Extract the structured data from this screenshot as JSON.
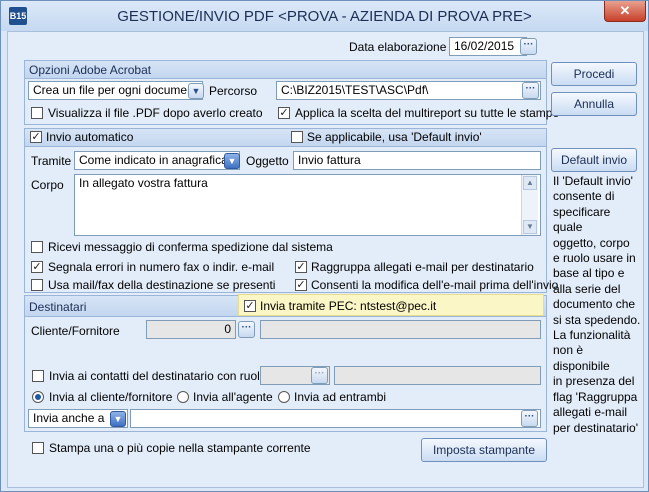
{
  "window": {
    "app_icon_text": "B15",
    "title": "GESTIONE/INVIO PDF <PROVA - AZIENDA DI PROVA PRE>",
    "close_glyph": "✕"
  },
  "header": {
    "data_label": "Data elaborazione",
    "data_value": "16/02/2015"
  },
  "opzioni": {
    "section_title": "Opzioni Adobe Acrobat",
    "file_mode": "Crea un file per ogni documento",
    "percorso_label": "Percorso",
    "percorso_value": "C:\\BIZ2015\\TEST\\ASC\\Pdf\\",
    "visualizza_label": "Visualizza il file .PDF dopo averlo creato",
    "visualizza_checked": false,
    "applica_label": "Applica la scelta del multireport su tutte le stampe",
    "applica_checked": true
  },
  "invio": {
    "auto_label": "Invio automatico",
    "auto_checked": true,
    "default_label": "Se applicabile, usa 'Default invio'",
    "default_checked": false,
    "tramite_label": "Tramite",
    "tramite_value": "Come indicato in anagrafica",
    "oggetto_label": "Oggetto",
    "oggetto_value": "Invio fattura",
    "corpo_label": "Corpo",
    "corpo_value": "In allegato vostra fattura",
    "ricevi_label": "Ricevi messaggio di conferma spedizione dal sistema",
    "ricevi_checked": false,
    "segnala_label": "Segnala errori in numero fax o indir. e-mail",
    "segnala_checked": true,
    "raggruppa_label": "Raggruppa allegati e-mail per destinatario",
    "raggruppa_checked": true,
    "usa_label": "Usa mail/fax della destinazione se presenti",
    "usa_checked": false,
    "consenti_label": "Consenti la modifica dell'e-mail prima dell'invio",
    "consenti_checked": true
  },
  "destinatari": {
    "section_title": "Destinatari",
    "pec_label": "Invia tramite PEC: ntstest@pec.it",
    "pec_checked": true,
    "cliente_label": "Cliente/Fornitore",
    "cliente_value": "0",
    "contatti_label": "Invia ai contatti del destinatario con ruolo",
    "contatti_checked": false,
    "radio_cliente": "Invia al cliente/fornitore",
    "radio_agente": "Invia all'agente",
    "radio_entrambi": "Invia ad entrambi",
    "radio_selected": "cliente",
    "invia_anche_label": "Invia anche a",
    "invia_anche_value": ""
  },
  "stampa": {
    "label": "Stampa una o più copie nella stampante corrente",
    "checked": false
  },
  "buttons": {
    "procedi": "Procedi",
    "annulla": "Annulla",
    "default_invio": "Default invio",
    "imposta_stampante": "Imposta stampante"
  },
  "help": {
    "lines": [
      "Il 'Default invio'",
      "consente di",
      "specificare quale",
      "oggetto, corpo",
      "e ruolo usare in",
      "base al tipo e",
      "alla serie del",
      "documento che",
      "si sta spedendo.",
      "La funzionalità",
      "non è disponibile",
      "in presenza del",
      "flag 'Raggruppa",
      "allegati e-mail",
      "per destinatario'"
    ]
  }
}
